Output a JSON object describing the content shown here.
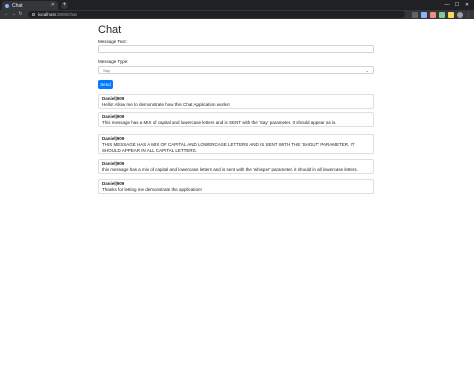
{
  "browser": {
    "tab_title": "Chat",
    "address_host": "localhost",
    "address_path": ":3000/chat"
  },
  "page": {
    "title": "Chat",
    "message_text_label": "Message Text:",
    "message_type_label": "Message Type:",
    "message_type_selected": "Say",
    "send_label": "Send"
  },
  "messages": [
    {
      "user": "Daniel|909",
      "text": "Hello! Allow me to demonstrate how this Chat Application works!"
    },
    {
      "user": "Daniel|909",
      "text": "This message has a MIX of capital and lowercase letters and is SENT with the 'Say' parameter. It should appear as is."
    },
    {
      "user": "Daniel|909",
      "text": "THIS MESSAGE HAS A MIX OF CAPITAL AND LOWERCASE LETTERS AND IS SENT WITH THE 'SHOUT' PARAMETER. IT SHOULD APPEAR IN ALL CAPITAL LETTERS."
    },
    {
      "user": "Daniel|909",
      "text": "this message has a mix of capital and lowercase letters and is sent with the 'whisper' parameter. it should in all lowercase letters."
    },
    {
      "user": "Daniel|909",
      "text": "Thanks for letting me demonstrate the application!"
    }
  ]
}
